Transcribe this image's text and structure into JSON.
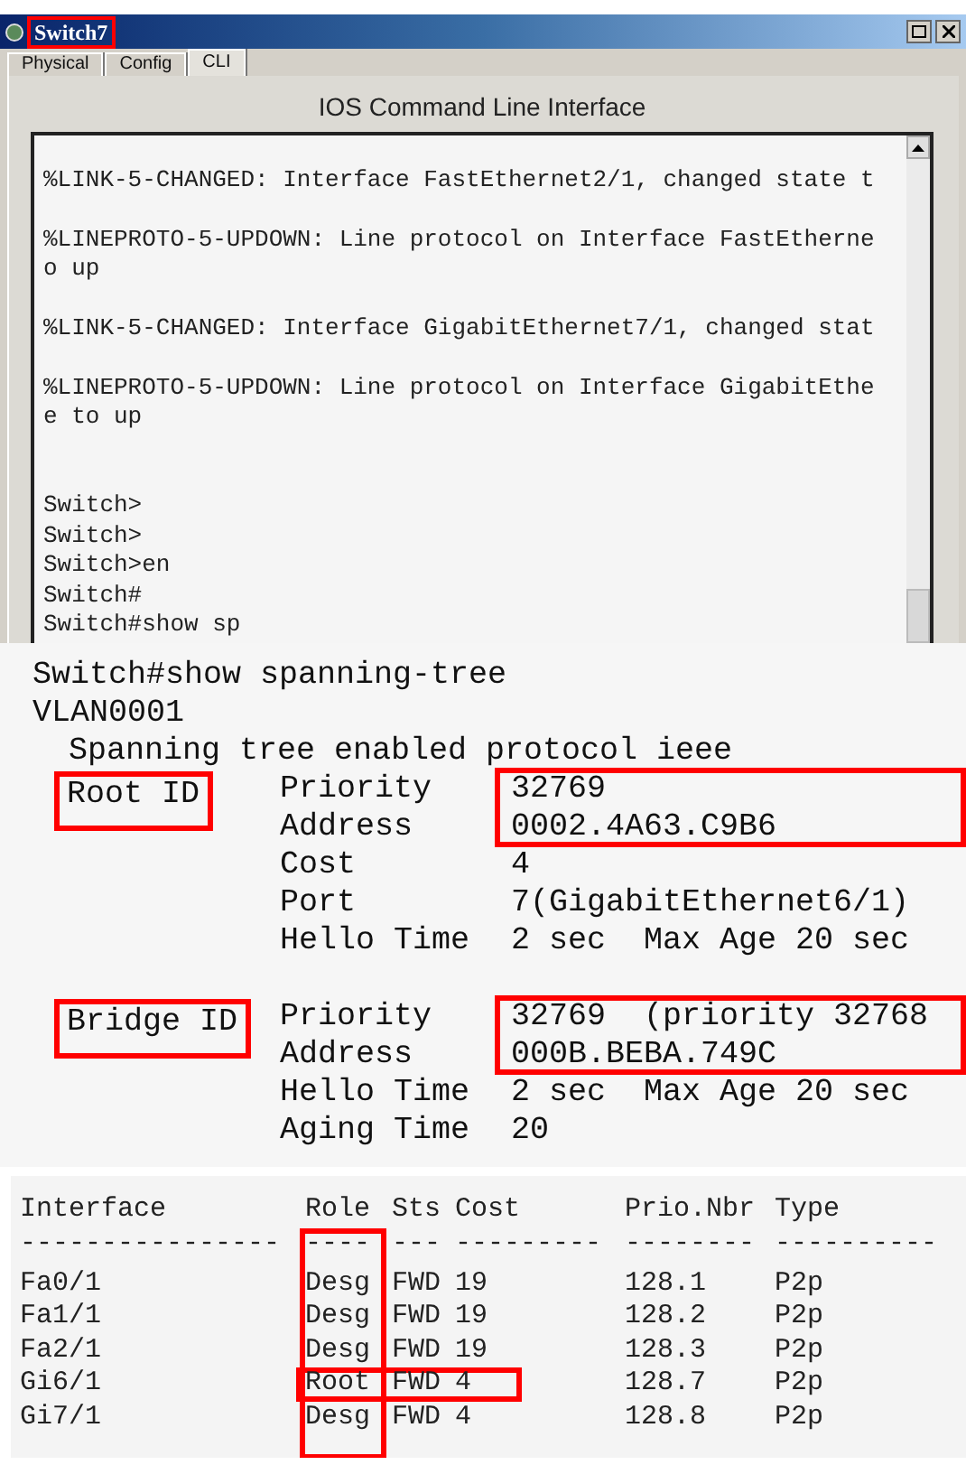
{
  "window": {
    "title": "Switch7",
    "title_highlighted": true
  },
  "tabs": [
    {
      "label": "Physical",
      "selected": false
    },
    {
      "label": "Config",
      "selected": false
    },
    {
      "label": "CLI",
      "selected": true
    }
  ],
  "cli": {
    "heading": "IOS Command Line Interface",
    "lines": [
      {
        "kind": "text",
        "text": "%LINK-5-CHANGED: Interface FastEthernet2/1, changed state t"
      },
      {
        "kind": "blank"
      },
      {
        "kind": "text",
        "text": "%LINEPROTO-5-UPDOWN: Line protocol on Interface FastEtherne"
      },
      {
        "kind": "text",
        "text": "o up"
      },
      {
        "kind": "blank"
      },
      {
        "kind": "text",
        "text": "%LINK-5-CHANGED: Interface GigabitEthernet7/1, changed stat"
      },
      {
        "kind": "blank"
      },
      {
        "kind": "text",
        "text": "%LINEPROTO-5-UPDOWN: Line protocol on Interface GigabitEthe"
      },
      {
        "kind": "text",
        "text": "e to up"
      },
      {
        "kind": "blank"
      },
      {
        "kind": "blank"
      },
      {
        "kind": "text",
        "text": "Switch>"
      },
      {
        "kind": "text",
        "text": "Switch>"
      },
      {
        "kind": "text",
        "text": "Switch>en"
      },
      {
        "kind": "text",
        "text": "Switch#"
      },
      {
        "kind": "text",
        "text": "Switch#show sp"
      }
    ]
  },
  "spanning_tree": {
    "command": "Switch#show spanning-tree",
    "vlan": "VLAN0001",
    "status": "Spanning tree enabled protocol ieee",
    "sections": [
      {
        "label": "Root ID",
        "highlighted": true,
        "groups": [
          {
            "highlighted": true,
            "fields": [
              {
                "key": "Priority",
                "value": "32769"
              },
              {
                "key": "Address",
                "value": "0002.4A63.C9B6"
              }
            ]
          },
          {
            "highlighted": false,
            "fields": [
              {
                "key": "Cost",
                "value": "4"
              },
              {
                "key": "Port",
                "value": "7(GigabitEthernet6/1)"
              },
              {
                "key": "Hello Time",
                "value": "2 sec  Max Age 20 sec"
              }
            ]
          }
        ]
      },
      {
        "label": "Bridge ID",
        "highlighted": true,
        "groups": [
          {
            "highlighted": true,
            "fields": [
              {
                "key": "Priority",
                "value": "32769  (priority 32768"
              },
              {
                "key": "Address",
                "value": "000B.BEBA.749C"
              }
            ]
          },
          {
            "highlighted": false,
            "fields": [
              {
                "key": "Hello Time",
                "value": "2 sec  Max Age 20 sec"
              },
              {
                "key": "Aging Time",
                "value": "20"
              }
            ]
          }
        ]
      }
    ]
  },
  "ports": {
    "columns": [
      {
        "label": "Interface",
        "rule": "----------------",
        "highlighted": false
      },
      {
        "label": "Role",
        "rule": "----",
        "highlighted": true
      },
      {
        "label": "Sts",
        "rule": "---",
        "highlighted": false
      },
      {
        "label": "Cost",
        "rule": "---------",
        "highlighted": false
      },
      {
        "label": "Prio.Nbr",
        "rule": "--------",
        "highlighted": false
      },
      {
        "label": "Type",
        "rule": "----------",
        "highlighted": false
      }
    ],
    "rows": [
      {
        "cells": [
          "Fa0/1",
          "Desg",
          "FWD",
          "19",
          "128.1",
          "P2p"
        ],
        "highlighted": false
      },
      {
        "cells": [
          "Fa1/1",
          "Desg",
          "FWD",
          "19",
          "128.2",
          "P2p"
        ],
        "highlighted": false
      },
      {
        "cells": [
          "Fa2/1",
          "Desg",
          "FWD",
          "19",
          "128.3",
          "P2p"
        ],
        "highlighted": false
      },
      {
        "cells": [
          "Gi6/1",
          "Root",
          "FWD",
          "4",
          "128.7",
          "P2p"
        ],
        "highlighted": true
      },
      {
        "cells": [
          "Gi7/1",
          "Desg",
          "FWD",
          "4",
          "128.8",
          "P2p"
        ],
        "highlighted": false
      }
    ]
  }
}
